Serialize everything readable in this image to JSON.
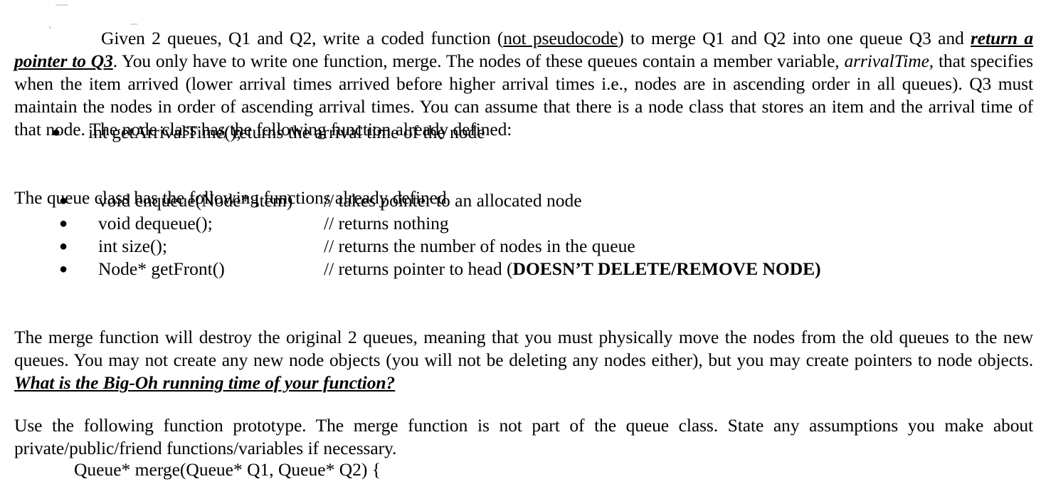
{
  "document": {
    "type": "assignment-question",
    "intro": {
      "lead_indent": "",
      "run1": "Given 2 queues, Q1 and Q2, write a coded function (",
      "run2_underline": "not pseudocode",
      "run3": ") to merge Q1 and Q2 into one queue Q3 and ",
      "run4_bold_italic_underline": "return a pointer to Q3",
      "run5": ". You only have to write one function, merge. The nodes of these queues contain a member variable, ",
      "run6_italic": "arrivalTime,",
      "run7": " that specifies when the item arrived (lower arrival times arrived before higher arrival times i.e., nodes are in ascending order in all queues). Q3 must maintain the nodes in order of ascending arrival times. You can assume that there is a node class that stores an item and the arrival time of that node. The node class has the following function already defined:"
    },
    "node_methods": {
      "bullet_glyph": "●",
      "items": [
        {
          "signature": "int getArrivalTime();",
          "comment": "// returns the arrival time of the node"
        }
      ]
    },
    "queue_intro": "The queue class has the following functions already defined",
    "queue_methods": {
      "bullet_glyph": "●",
      "items": [
        {
          "signature": "void enqueue(Node* item)",
          "comment_prefix": "// takes pointer to an allocated node",
          "comment_bold": ""
        },
        {
          "signature": "void dequeue();",
          "comment_prefix": "// returns nothing",
          "comment_bold": ""
        },
        {
          "signature": "int size();",
          "comment_prefix": "// returns the number of nodes in the queue",
          "comment_bold": ""
        },
        {
          "signature": "Node* getFront()",
          "comment_prefix": "// returns pointer to head (",
          "comment_bold": "DOESN’T DELETE/REMOVE NODE)"
        }
      ]
    },
    "merge_paragraph": {
      "run1": "The merge function will destroy the original 2 queues, meaning that you must physically move the nodes from the old queues to the new queues. You may not create any new node objects (you will not be deleting any nodes either), but you may create pointers to node objects.  ",
      "run2_bold_italic_underline": "What is the Big-Oh running time of your function?"
    },
    "prototype_paragraph": "Use the following function prototype. The merge function is not part of the queue class. State any assumptions you make about private/public/friend functions/variables if necessary.",
    "prototype_signature": "Queue* merge(Queue* Q1, Queue* Q2) {"
  }
}
